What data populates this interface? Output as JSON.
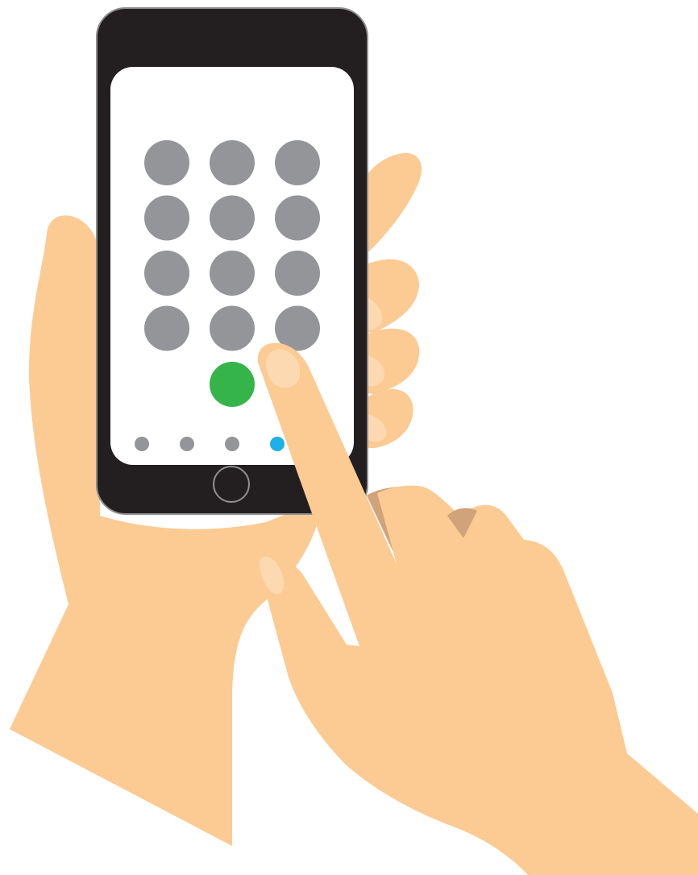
{
  "colors": {
    "background": "#ffffff",
    "skin": "#FBCB93",
    "skin_shadow": "#D0A37A",
    "nail": "#FCD9B1",
    "phone_body": "#231F20",
    "phone_edge": "#8E8D8F",
    "screen": "#ffffff",
    "key": "#939598",
    "call_key": "#35B44A",
    "page_dot": "#939598",
    "page_dot_active": "#1EB1E7",
    "home_button": "#231F20",
    "home_button_ring": "#8E8D8F"
  },
  "keypad": {
    "rows": 4,
    "columns": 3,
    "key_icon": "keypad-key-icon",
    "call_icon": "call-button-icon"
  },
  "page_indicator": {
    "count": 4,
    "active_index": 3
  },
  "icons": {
    "home_button": "home-button-icon",
    "left_hand": "left-hand-icon",
    "right_hand": "right-hand-icon"
  }
}
